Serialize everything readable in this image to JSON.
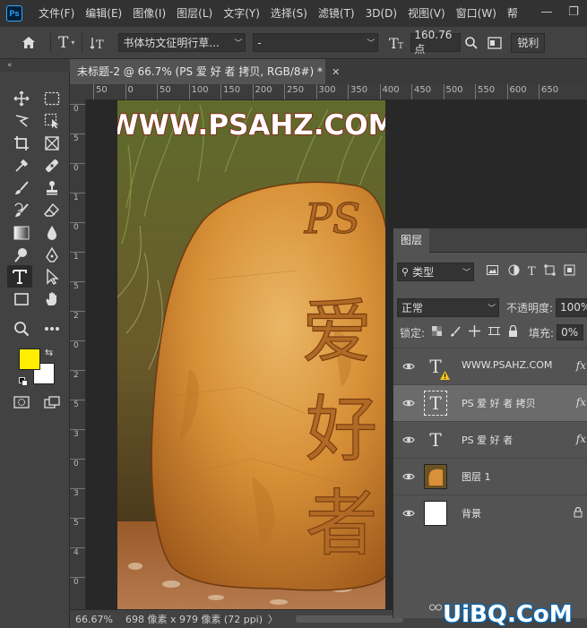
{
  "app": {
    "logo": "Ps"
  },
  "menu": [
    "文件(F)",
    "编辑(E)",
    "图像(I)",
    "图层(L)",
    "文字(Y)",
    "选择(S)",
    "滤镜(T)",
    "3D(D)",
    "视图(V)",
    "窗口(W)",
    "帮"
  ],
  "window_controls": {
    "minimize": "—",
    "restore": "❐"
  },
  "options": {
    "font_family": "书体坊文征明行草...",
    "font_style": "-",
    "font_size": "160.76 点",
    "antialias": "锐利"
  },
  "collapse_glyph": "«",
  "document": {
    "tab_title": "未标题-2 @ 66.7% (PS 爱 好 者 拷贝, RGB/8#) *",
    "close": "✕"
  },
  "ruler": {
    "h_ticks": [
      "50",
      "0",
      "50",
      "100",
      "150",
      "200",
      "250",
      "300",
      "350",
      "400",
      "450",
      "500",
      "550",
      "600",
      "650"
    ],
    "v_ticks": [
      "0",
      "5",
      "0",
      "1",
      "0",
      "1",
      "5",
      "2",
      "0",
      "2",
      "5",
      "3",
      "0",
      "3",
      "5",
      "4",
      "0"
    ]
  },
  "canvas": {
    "headline": "WWW.PSAHZ.COM",
    "carved_text": [
      "PS",
      "爱",
      "好",
      "者"
    ]
  },
  "status": {
    "zoom": "66.67%",
    "info": "698 像素 x 979 像素 (72 ppi)",
    "arrow": "〉"
  },
  "layers_panel": {
    "tab": "图层",
    "filter_label": "类型",
    "blend_mode": "正常",
    "opacity_label": "不透明度:",
    "opacity_value": "100%",
    "lock_label": "锁定:",
    "fill_label": "填充:",
    "fill_value": "0%",
    "layers": [
      {
        "name": "WWW.PSAHZ.COM",
        "type": "text",
        "fx": "fx",
        "selected": false,
        "warning": true
      },
      {
        "name": "PS 爱 好 者 拷贝",
        "type": "text",
        "fx": "fx",
        "selected": true,
        "warning": false
      },
      {
        "name": "PS 爱 好 者",
        "type": "text",
        "fx": "fx",
        "selected": false,
        "warning": false
      },
      {
        "name": "图层 1",
        "type": "image",
        "fx": "",
        "selected": false,
        "warning": false
      },
      {
        "name": "背景",
        "type": "background",
        "fx": "",
        "selected": false,
        "warning": false
      }
    ]
  },
  "colors": {
    "foreground": "#ffee00",
    "background": "#ffffff",
    "headline_fill": "#ffffff",
    "headline_stroke": "#8b1a10",
    "rock": "#d98a2e"
  },
  "watermark": "UiBQ.CoM"
}
